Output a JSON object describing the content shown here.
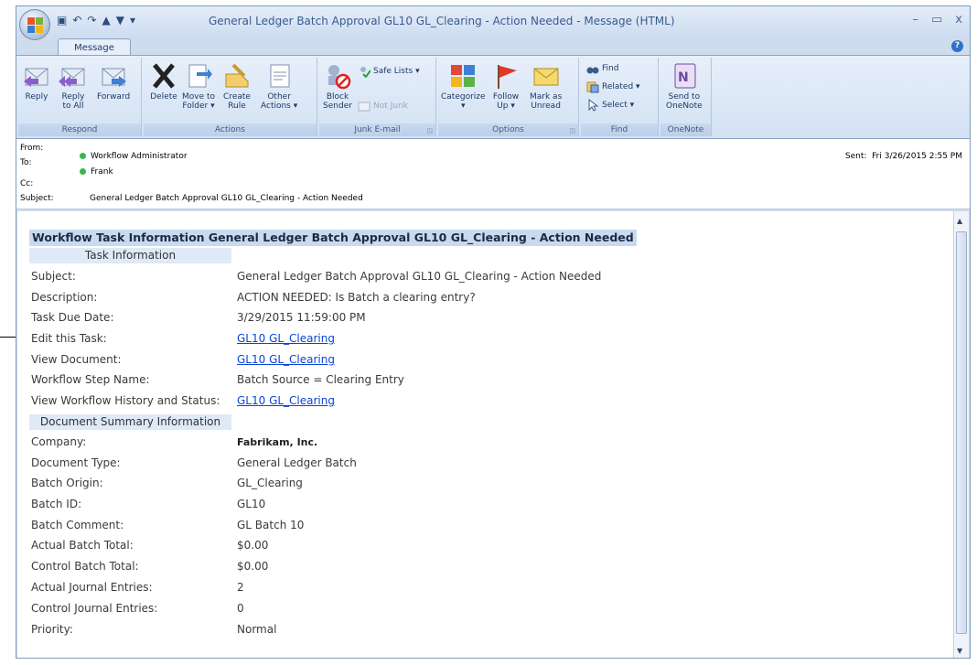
{
  "window": {
    "title": "General Ledger Batch Approval GL10 GL_Clearing - Action Needed - Message (HTML)",
    "controls": {
      "minimize": "–",
      "maximize": "▭",
      "close": "x"
    }
  },
  "ribbon": {
    "tab": "Message",
    "groups": {
      "respond": {
        "label": "Respond",
        "reply": "Reply",
        "reply_all_1": "Reply",
        "reply_all_2": "to All",
        "forward": "Forward"
      },
      "actions": {
        "label": "Actions",
        "delete": "Delete",
        "move_1": "Move to",
        "move_2": "Folder ▾",
        "create_1": "Create",
        "create_2": "Rule",
        "other_1": "Other",
        "other_2": "Actions ▾"
      },
      "junk": {
        "label": "Junk E-mail",
        "block_1": "Block",
        "block_2": "Sender",
        "safe_lists": "Safe Lists ▾",
        "not_junk": "Not Junk"
      },
      "options": {
        "label": "Options",
        "categorize": "Categorize",
        "categorize_2": "▾",
        "follow_1": "Follow",
        "follow_2": "Up ▾",
        "mark_1": "Mark as",
        "mark_2": "Unread"
      },
      "find": {
        "label": "Find",
        "find": "Find",
        "related": "Related ▾",
        "select": "Select ▾"
      },
      "onenote": {
        "label": "OneNote",
        "send_1": "Send to",
        "send_2": "OneNote"
      }
    }
  },
  "header": {
    "from_label": "From:",
    "from": "Workflow Administrator",
    "to_label": "To:",
    "to": "Frank",
    "cc_label": "Cc:",
    "subject_label": "Subject:",
    "subject": "General Ledger Batch Approval GL10 GL_Clearing - Action Needed",
    "sent_label": "Sent:",
    "sent": "Fri 3/26/2015 2:55 PM"
  },
  "body": {
    "heading": "Workflow Task Information General Ledger Batch Approval GL10 GL_Clearing - Action Needed",
    "task_section": "Task Information",
    "task_rows": [
      {
        "label": "Subject:",
        "value": "General Ledger Batch Approval GL10 GL_Clearing - Action Needed"
      },
      {
        "label": "Description:",
        "value": "ACTION NEEDED: Is Batch a clearing entry?"
      },
      {
        "label": "Task Due Date:",
        "value": "3/29/2015 11:59:00 PM"
      },
      {
        "label": "Edit this Task:",
        "value": "GL10 GL_Clearing"
      },
      {
        "label": "View Document:",
        "value": "GL10 GL_Clearing"
      },
      {
        "label": "Workflow Step Name:",
        "value": "Batch Source = Clearing Entry"
      },
      {
        "label": "View Workflow History and Status:",
        "value": "GL10 GL_Clearing"
      }
    ],
    "doc_section": "Document Summary Information",
    "doc_rows": [
      {
        "label": "Company:",
        "value": "Fabrikam, Inc."
      },
      {
        "label": "Document Type:",
        "value": "General Ledger Batch"
      },
      {
        "label": "Batch Origin:",
        "value": "GL_Clearing"
      },
      {
        "label": "Batch ID:",
        "value": "GL10"
      },
      {
        "label": "Batch Comment:",
        "value": "GL Batch 10"
      },
      {
        "label": "Actual Batch Total:",
        "value": "$0.00"
      },
      {
        "label": "Control Batch Total:",
        "value": "$0.00"
      },
      {
        "label": "Actual Journal Entries:",
        "value": "2"
      },
      {
        "label": "Control Journal Entries:",
        "value": "0"
      },
      {
        "label": "Priority:",
        "value": "Normal"
      }
    ]
  }
}
